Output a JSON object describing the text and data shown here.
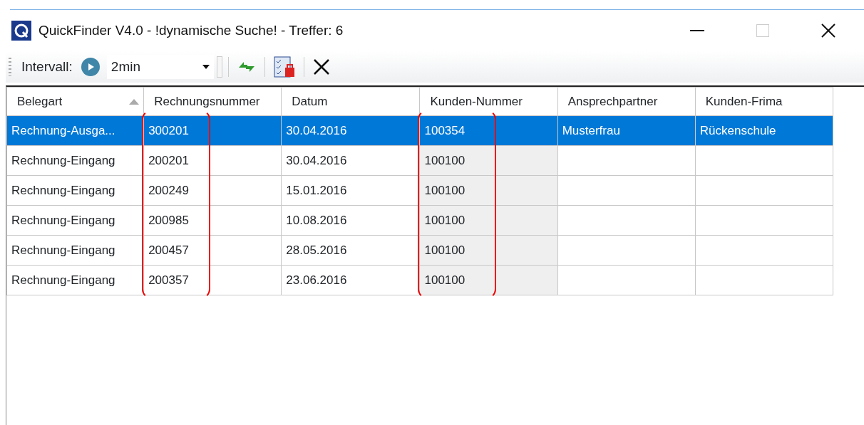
{
  "window": {
    "title": "QuickFinder V4.0 - !dynamische Suche! - Treffer: 6"
  },
  "toolbar": {
    "interval_label": "Intervall:",
    "interval_value": "2min"
  },
  "table": {
    "columns": [
      {
        "label": "Belegart",
        "sorted": true
      },
      {
        "label": "Rechnungsnummer",
        "sorted": false,
        "highlighted": true
      },
      {
        "label": "Datum",
        "sorted": false
      },
      {
        "label": "Kunden-Nummer",
        "sorted": false,
        "highlighted": true
      },
      {
        "label": "Ansprechpartner",
        "sorted": false
      },
      {
        "label": "Kunden-Frima",
        "sorted": false
      }
    ],
    "rows": [
      {
        "selected": true,
        "cells": [
          "Rechnung-Ausga...",
          "300201",
          "30.04.2016",
          "100354",
          "Musterfrau",
          "Rückenschule"
        ]
      },
      {
        "selected": false,
        "cells": [
          "Rechnung-Eingang",
          "200201",
          "30.04.2016",
          "100100",
          "",
          ""
        ]
      },
      {
        "selected": false,
        "cells": [
          "Rechnung-Eingang",
          "200249",
          "15.01.2016",
          "100100",
          "",
          ""
        ]
      },
      {
        "selected": false,
        "cells": [
          "Rechnung-Eingang",
          "200985",
          "10.08.2016",
          "100100",
          "",
          ""
        ]
      },
      {
        "selected": false,
        "cells": [
          "Rechnung-Eingang",
          "200457",
          "28.05.2016",
          "100100",
          "",
          ""
        ]
      },
      {
        "selected": false,
        "cells": [
          "Rechnung-Eingang",
          "200357",
          "23.06.2016",
          "100100",
          "",
          ""
        ]
      }
    ]
  }
}
